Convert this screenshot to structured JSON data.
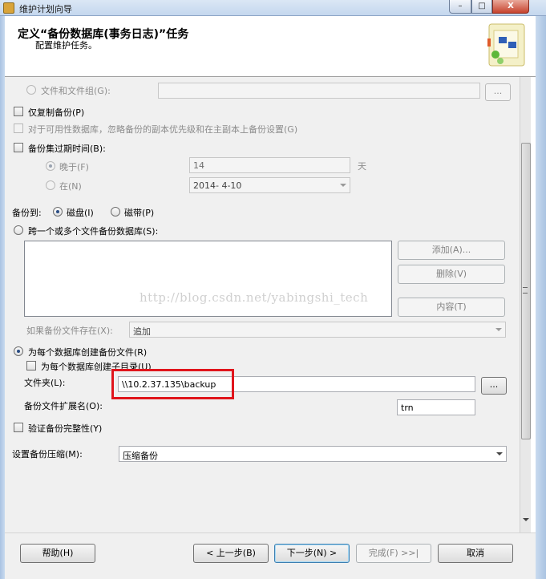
{
  "window": {
    "title": "维护计划向导",
    "controls": {
      "minimize": "–",
      "maximize": "□",
      "close": "X"
    }
  },
  "header": {
    "title": "定义“备份数据库(事务日志)”任务",
    "subtitle": "配置维护任务。"
  },
  "options": {
    "files_and_filegroups": {
      "label": "文件和文件组(G):",
      "value": "",
      "browse": "..."
    },
    "copy_only": {
      "label": "仅复制备份(P)"
    },
    "availability": {
      "label": "对于可用性数据库，忽略备份的副本优先级和在主副本上备份设置(G)"
    },
    "backup_set_expire": {
      "label": "备份集过期时间(B):"
    },
    "later_than": {
      "label": "晚于(F)",
      "value": "14",
      "unit": "天"
    },
    "on_date": {
      "label": "在(N)",
      "value": "2014- 4-10"
    }
  },
  "backup_to": {
    "label": "备份到:",
    "disk": "磁盘(I)",
    "tape": "磁带(P)"
  },
  "span_files": {
    "label": "跨一个或多个文件备份数据库(S):",
    "add_button": "添加(A)...",
    "delete_button": "删除(V)",
    "content_button": "内容(T)",
    "if_exists_label": "如果备份文件存在(X):",
    "if_exists_value": "追加"
  },
  "per_database": {
    "label": "为每个数据库创建备份文件(R)",
    "subdir_label": "为每个数据库创建子目录(U)",
    "folder_label": "文件夹(L):",
    "folder_value": "\\\\10.2.37.135\\backup",
    "browse": "...",
    "ext_label": "备份文件扩展名(O):",
    "ext_value": "trn"
  },
  "verify": {
    "label": "验证备份完整性(Y)"
  },
  "compression": {
    "label": "设置备份压缩(M):",
    "value": "压缩备份"
  },
  "watermark": "http://blog.csdn.net/yabingshi_tech",
  "footer": {
    "help": "帮助(H)",
    "back": "< 上一步(B)",
    "next": "下一步(N) >",
    "finish": "完成(F) >>|",
    "cancel": "取消"
  },
  "colors": {
    "highlight_box": "#e0151c",
    "window_frame": "#c4d7ee",
    "panel_bg": "#f0f0f0"
  }
}
